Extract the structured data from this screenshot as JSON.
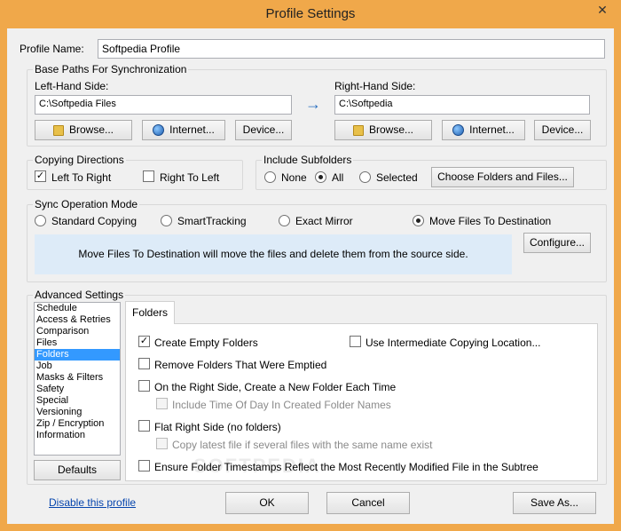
{
  "window": {
    "title": "Profile Settings",
    "close_glyph": "✕"
  },
  "profile": {
    "label": "Profile Name:",
    "value": "Softpedia Profile"
  },
  "base_paths": {
    "title": "Base Paths For Synchronization",
    "left_label": "Left-Hand Side:",
    "left_value": "C:\\Softpedia Files",
    "right_label": "Right-Hand Side:",
    "right_value": "C:\\Softpedia",
    "browse": "Browse...",
    "internet": "Internet...",
    "device": "Device...",
    "arrow_glyph": "→"
  },
  "copying_directions": {
    "title": "Copying Directions",
    "left_to_right": {
      "label": "Left To Right",
      "checked": true
    },
    "right_to_left": {
      "label": "Right To Left",
      "checked": false
    }
  },
  "include_subfolders": {
    "title": "Include Subfolders",
    "options": [
      "None",
      "All",
      "Selected"
    ],
    "selected": "All",
    "choose_button": "Choose Folders and Files..."
  },
  "sync_mode": {
    "title": "Sync Operation Mode",
    "options": [
      "Standard Copying",
      "SmartTracking",
      "Exact Mirror",
      "Move Files To Destination"
    ],
    "selected": "Move Files To Destination",
    "description": "Move Files To Destination will move the files and delete them from the source side.",
    "configure": "Configure..."
  },
  "advanced": {
    "title": "Advanced Settings",
    "items": [
      "Schedule",
      "Access & Retries",
      "Comparison",
      "Files",
      "Folders",
      "Job",
      "Masks & Filters",
      "Safety",
      "Special",
      "Versioning",
      "Zip / Encryption",
      "Information"
    ],
    "selected_item": "Folders",
    "defaults_button": "Defaults",
    "tab_label": "Folders",
    "options": {
      "create_empty": {
        "label": "Create Empty Folders",
        "checked": true
      },
      "intermediate": {
        "label": "Use Intermediate Copying Location...",
        "checked": false
      },
      "remove_emptied": {
        "label": "Remove Folders That Were Emptied",
        "checked": false
      },
      "new_folder_each_time": {
        "label": "On the Right Side, Create a New Folder Each Time",
        "checked": false
      },
      "include_time": {
        "label": "Include Time Of Day In Created Folder Names",
        "checked": false,
        "disabled": true
      },
      "flat_right": {
        "label": "Flat Right Side (no folders)",
        "checked": false
      },
      "copy_latest": {
        "label": "Copy latest file if several files with the same name exist",
        "checked": false,
        "disabled": true
      },
      "timestamps": {
        "label": "Ensure Folder Timestamps Reflect the Most Recently Modified File in the Subtree",
        "checked": false
      }
    }
  },
  "footer": {
    "disable_link": "Disable this profile",
    "ok": "OK",
    "cancel": "Cancel",
    "save_as": "Save As..."
  },
  "watermark": "SOFTPEDIA"
}
